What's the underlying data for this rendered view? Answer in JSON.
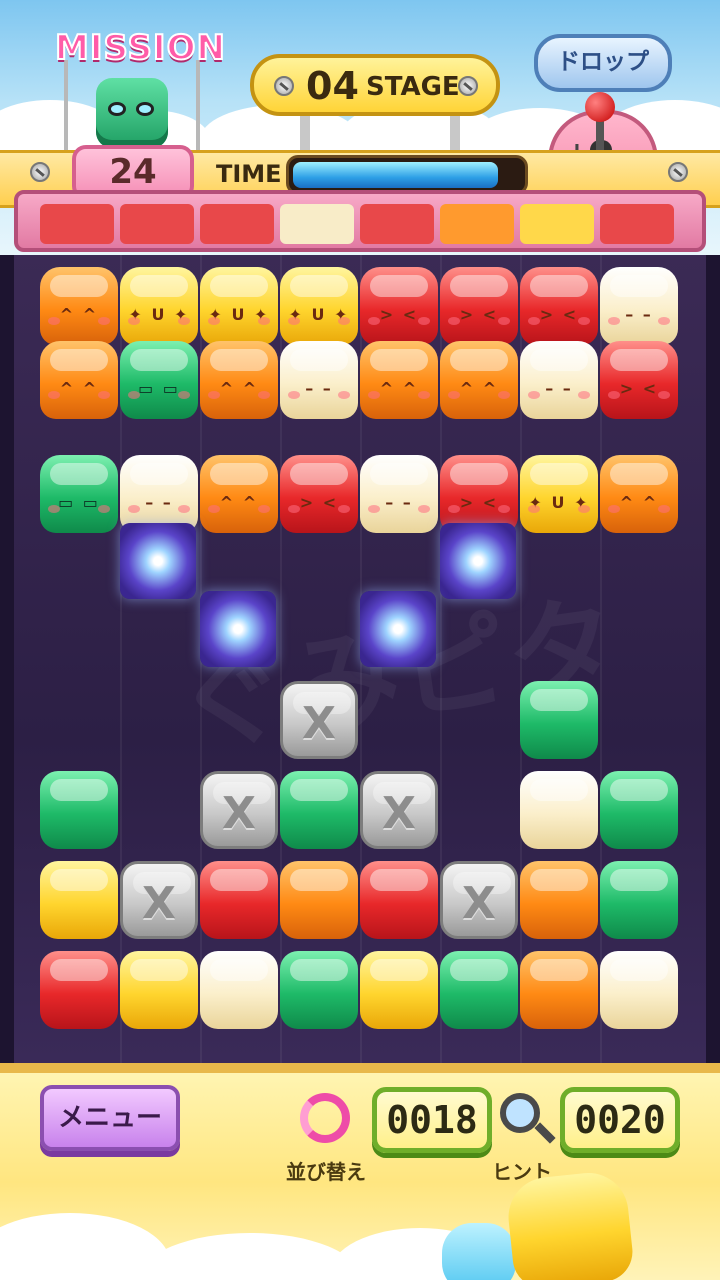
{
  "header": {
    "mission_label": "MISSION",
    "mission_count": "24",
    "stage_number": "04",
    "stage_label": "STAGE",
    "drop_button_label": "ドロップ",
    "time_label": "TIME",
    "time_remaining_fraction": 0.9
  },
  "next_row_colors": [
    "red",
    "red",
    "red",
    "cream",
    "red",
    "orange",
    "yellow",
    "red"
  ],
  "board": {
    "watermark": "ぐみピタ",
    "rows": [
      [
        "orange-face",
        "yellow-face",
        "yellow-face",
        "yellow-face",
        "red-face",
        "red-face",
        "red-face",
        "cream-face"
      ],
      [
        "orange-face",
        "green-face",
        "orange-face",
        "cream-face",
        "orange-face",
        "orange-face",
        "cream-face",
        "red-face"
      ],
      [
        null,
        null,
        null,
        null,
        null,
        null,
        null,
        null
      ],
      [
        "green-face",
        "cream-face",
        "orange-face",
        "red-face",
        "cream-face",
        "red-face",
        "yellow-face",
        "orange-face"
      ],
      [
        null,
        "gem",
        null,
        null,
        null,
        "gem",
        null,
        null
      ],
      [
        null,
        null,
        "gem",
        null,
        "gem",
        null,
        null,
        null
      ],
      [
        null,
        null,
        null,
        "gray",
        null,
        null,
        "green",
        null
      ],
      [
        "green",
        null,
        "gray",
        "green",
        "gray",
        null,
        "cream",
        "green"
      ],
      [
        "yellow",
        "gray",
        "red",
        "orange",
        "red",
        "gray",
        "orange",
        "green"
      ],
      [
        "red",
        "yellow",
        "cream",
        "green",
        "yellow",
        "green",
        "orange",
        "cream"
      ]
    ],
    "gray_mark": "X"
  },
  "footer": {
    "menu_label": "メニュー",
    "shuffle_label": "並び替え",
    "shuffle_count": "0018",
    "hint_label": "ヒント",
    "hint_count": "0020"
  },
  "colors": {
    "accent_pink": "#ff5ca8",
    "counter_green": "#6fae2a",
    "board_bg": "#2c1f45"
  }
}
